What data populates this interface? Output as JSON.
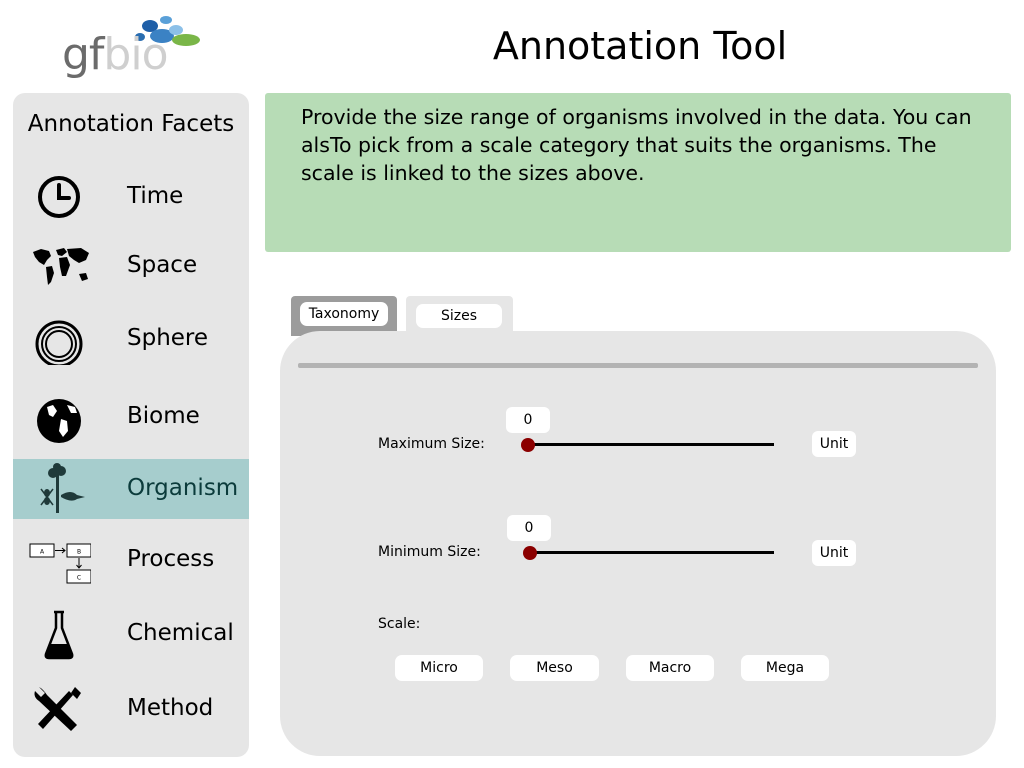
{
  "app": {
    "logo": {
      "part1": "gf",
      "part2": "bio"
    },
    "title": "Annotation Tool"
  },
  "sidebar": {
    "heading": "Annotation Facets",
    "items": [
      {
        "label": "Time",
        "icon": "clock-icon",
        "active": false
      },
      {
        "label": "Space",
        "icon": "world-map-icon",
        "active": false
      },
      {
        "label": "Sphere",
        "icon": "concentric-circles-icon",
        "active": false
      },
      {
        "label": "Biome",
        "icon": "globe-icon",
        "active": false
      },
      {
        "label": "Organism",
        "icon": "organism-icon",
        "active": true
      },
      {
        "label": "Process",
        "icon": "flowchart-icon",
        "active": false
      },
      {
        "label": "Chemical",
        "icon": "flask-icon",
        "active": false
      },
      {
        "label": "Method",
        "icon": "tools-icon",
        "active": false
      }
    ],
    "process_icon_boxes": [
      "A",
      "B",
      "C"
    ]
  },
  "instruction": {
    "text": "Provide the size range of organisms involved in the data. You can alsTo pick from a scale category that suits the organisms. The scale is linked to the sizes above."
  },
  "tabs": [
    {
      "label": "Taxonomy",
      "selected": true
    },
    {
      "label": "Sizes",
      "selected": false
    }
  ],
  "sizes": {
    "maximum": {
      "label": "Maximum Size:",
      "value": "0",
      "unit": "Unit"
    },
    "minimum": {
      "label": "Minimum Size:",
      "value": "0",
      "unit": "Unit"
    },
    "scale_label": "Scale:",
    "scale_options": [
      "Micro",
      "Meso",
      "Macro",
      "Mega"
    ]
  },
  "colors": {
    "sidebar_bg": "#e6e6e6",
    "active_facet": "#a6cdcd",
    "instruction_bg": "#b7dcb6",
    "slider_thumb": "#8b0000",
    "logo_blue": "#3b82c4",
    "logo_green": "#7ab648"
  }
}
